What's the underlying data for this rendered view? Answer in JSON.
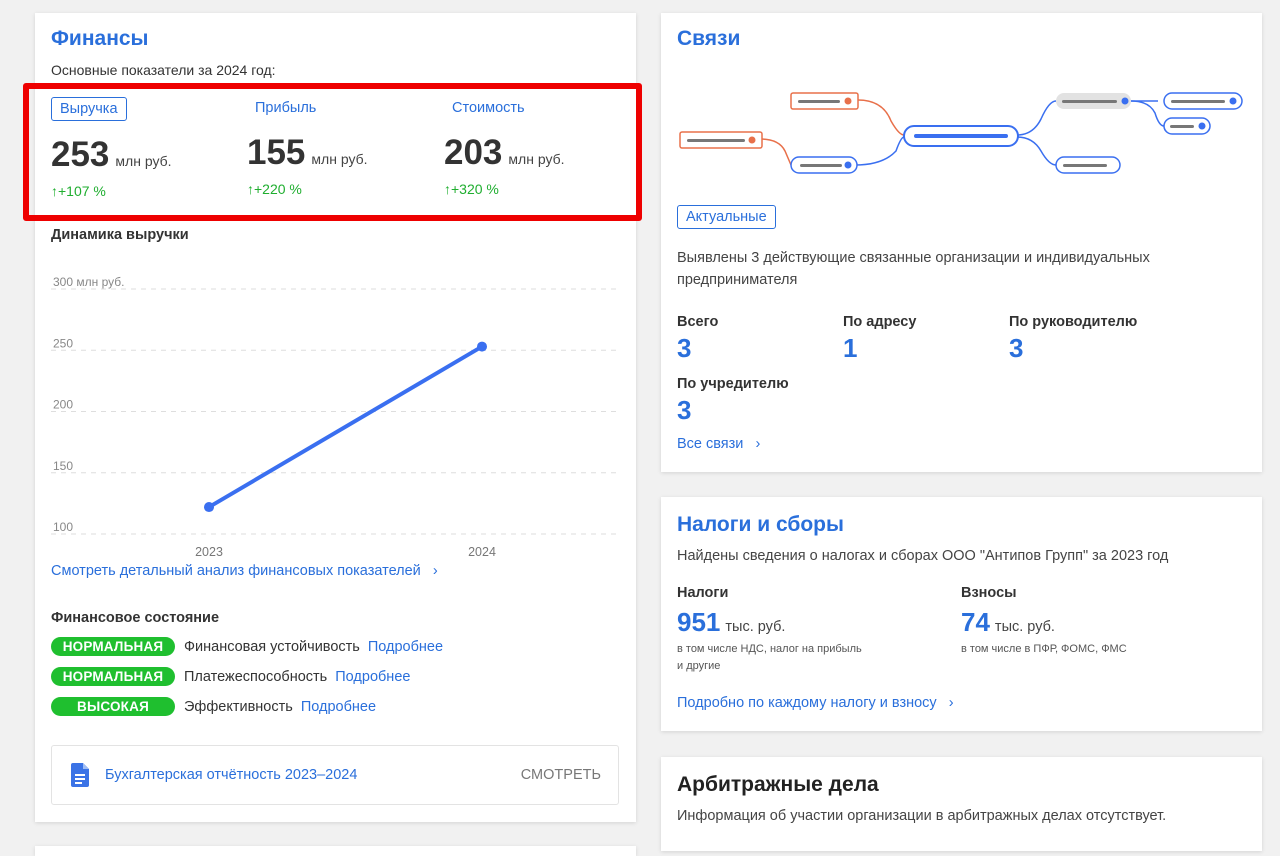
{
  "finance": {
    "title": "Финансы",
    "subtitle": "Основные показатели за 2024 год:",
    "metrics": [
      {
        "label": "Выручка",
        "value": "253",
        "unit": "млн руб.",
        "change": "↑+107 %"
      },
      {
        "label": "Прибыль",
        "value": "155",
        "unit": "млн руб.",
        "change": "↑+220 %"
      },
      {
        "label": "Стоимость",
        "value": "203",
        "unit": "млн руб.",
        "change": "↑+320 %"
      }
    ],
    "chart_title": "Динамика выручки",
    "detail_link": "Смотреть детальный анализ финансовых показателей",
    "state_title": "Финансовое состояние",
    "states": [
      {
        "badge": "НОРМАЛЬНАЯ",
        "label": "Финансовая устойчивость",
        "more": "Подробнее"
      },
      {
        "badge": "НОРМАЛЬНАЯ",
        "label": "Платежеспособность",
        "more": "Подробнее"
      },
      {
        "badge": "ВЫСОКАЯ",
        "label": "Эффективность",
        "more": "Подробнее"
      }
    ],
    "report": {
      "title": "Бухгалтерская отчётность 2023–2024",
      "action": "СМОТРЕТЬ"
    }
  },
  "chart_data": {
    "type": "line",
    "title": "Динамика выручки",
    "categories": [
      "2023",
      "2024"
    ],
    "series": [
      {
        "values": [
          122,
          253
        ]
      }
    ],
    "y_ticks": [
      "300 млн руб.",
      "250",
      "200",
      "150",
      "100"
    ],
    "ylim": [
      100,
      300
    ],
    "grid": true,
    "color": "#3a6ff0"
  },
  "links": {
    "title": "Связи",
    "badge": "Актуальные",
    "description": "Выявлены 3 действующие связанные организации и индивидуальных предпринимателя",
    "stats": [
      {
        "label": "Всего",
        "value": "3"
      },
      {
        "label": "По адресу",
        "value": "1"
      },
      {
        "label": "По руководителю",
        "value": "3"
      },
      {
        "label": "По учредителю",
        "value": "3"
      }
    ],
    "all_link": "Все связи"
  },
  "taxes": {
    "title": "Налоги и сборы",
    "description": "Найдены сведения о налогах и сборах ООО \"Антипов Групп\" за 2023 год",
    "items": [
      {
        "label": "Налоги",
        "value": "951",
        "unit": "тыс. руб.",
        "note1": "в том числе НДС, налог на прибыль",
        "note2": "и другие"
      },
      {
        "label": "Взносы",
        "value": "74",
        "unit": "тыс. руб.",
        "note1": "в том числе в ПФР, ФОМС, ФМС",
        "note2": ""
      }
    ],
    "link": "Подробно по каждому налогу и взносу"
  },
  "arbitration": {
    "title": "Арбитражные дела",
    "description": "Информация об участии организации в арбитражных делах отсутствует."
  },
  "colors": {
    "accent": "#2a6fdb",
    "positive": "#1fae2f",
    "badge": "#1fbf2f",
    "highlight": "#ee0000",
    "node_orange": "#e8704a"
  }
}
